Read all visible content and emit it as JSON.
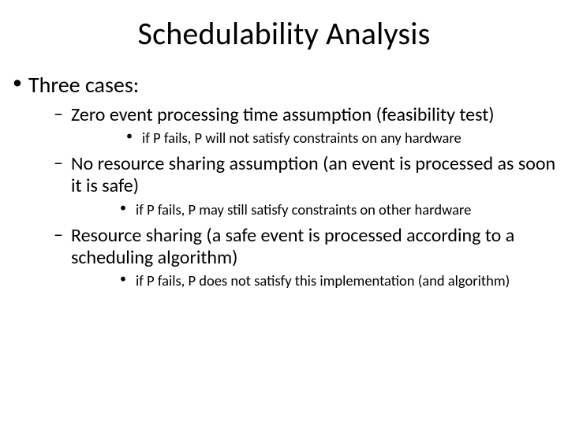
{
  "title": "Schedulability Analysis",
  "bullets": {
    "lvl1": "Three cases:",
    "items": [
      {
        "lvl2": "Zero event processing time assumption (feasibility test)",
        "lvl3": "if P fails, P will not satisfy constraints on any hardware"
      },
      {
        "lvl2": "No resource sharing assumption (an event is processed as soon it is safe)",
        "lvl3": "if P fails, P may still satisfy constraints on other hardware"
      },
      {
        "lvl2": "Resource sharing (a safe event is processed according to a scheduling algorithm)",
        "lvl3": "if P fails, P does not satisfy this implementation (and algorithm)"
      }
    ]
  }
}
